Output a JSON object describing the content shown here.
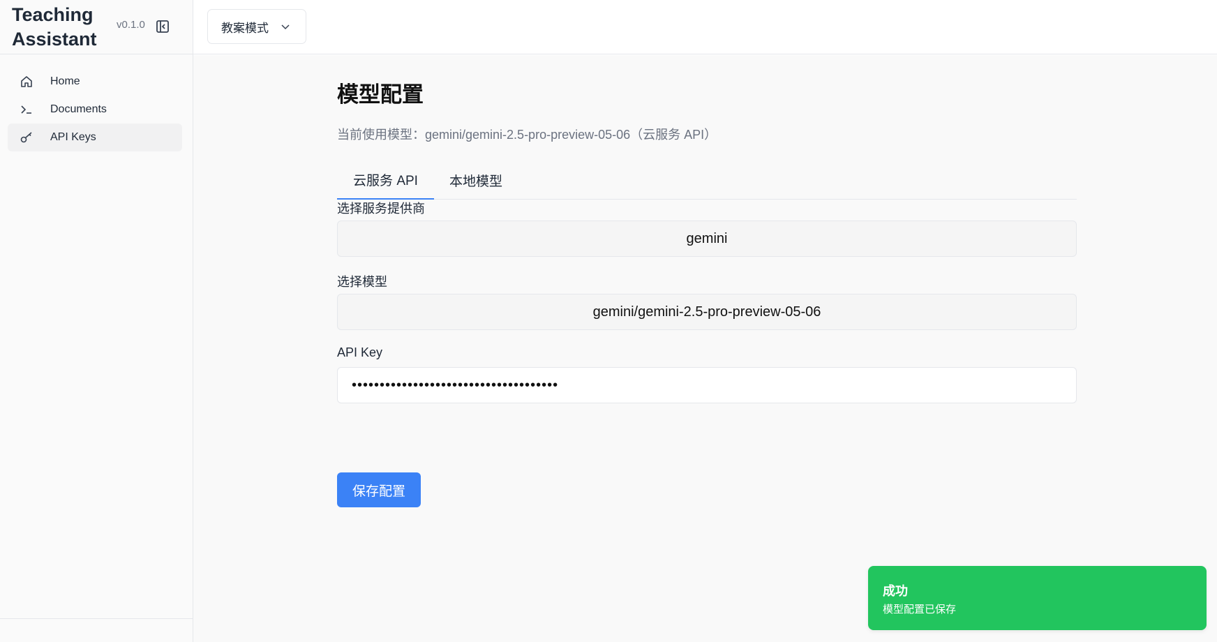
{
  "app": {
    "title": "Teaching Assistant",
    "version": "v0.1.0"
  },
  "sidebar": {
    "items": [
      {
        "label": "Home",
        "icon": "home-icon"
      },
      {
        "label": "Documents",
        "icon": "terminal-icon"
      },
      {
        "label": "API Keys",
        "icon": "key-icon",
        "active": true
      }
    ]
  },
  "topbar": {
    "mode_label": "教案模式"
  },
  "main": {
    "title": "模型配置",
    "current_model": "当前使用模型：gemini/gemini-2.5-pro-preview-05-06（云服务 API）",
    "tabs": [
      {
        "label": "云服务 API",
        "active": true
      },
      {
        "label": "本地模型",
        "active": false
      }
    ],
    "provider_label": "选择服务提供商",
    "provider_value": "gemini",
    "model_label": "选择模型",
    "model_value": "gemini/gemini-2.5-pro-preview-05-06",
    "api_key_label": "API Key",
    "api_key_value": "•••••••••••••••••••••••••••••••••••••",
    "save_label": "保存配置"
  },
  "toast": {
    "title": "成功",
    "message": "模型配置已保存"
  },
  "colors": {
    "accent": "#3b82f6",
    "success": "#22c55e"
  }
}
